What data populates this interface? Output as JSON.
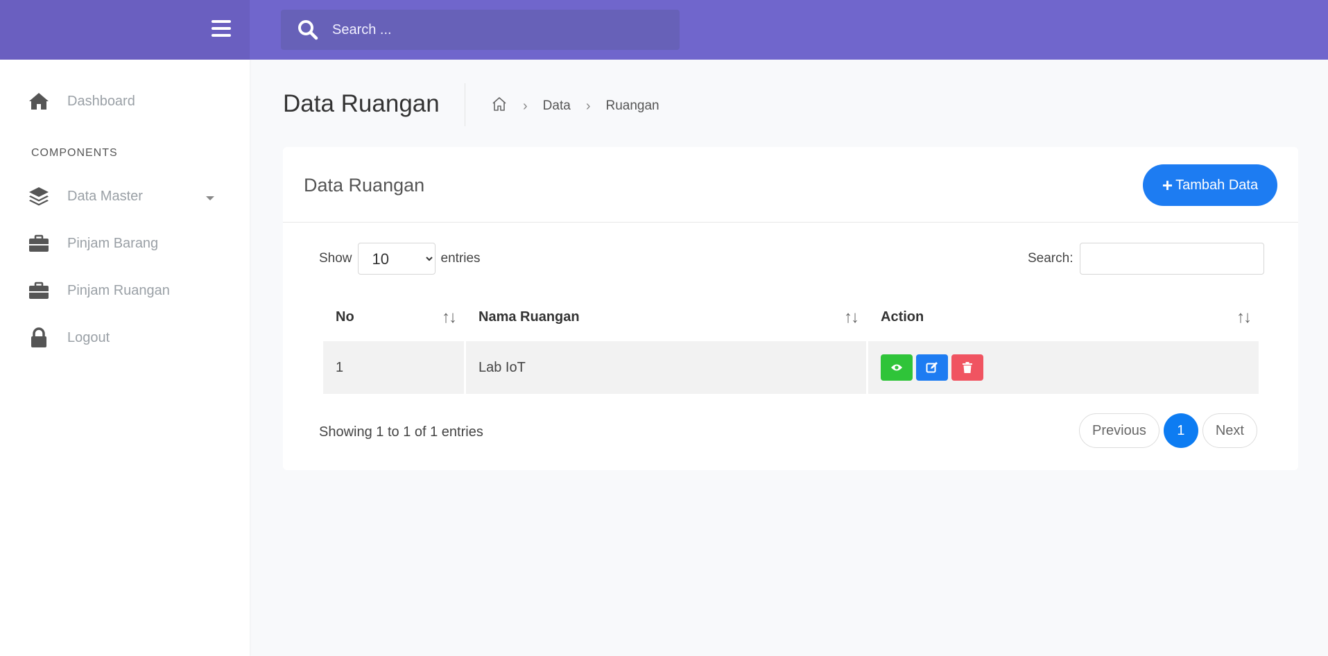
{
  "topbar": {
    "search_placeholder": "Search ...",
    "menu_icon": "hamburger-icon",
    "search_icon": "search-icon"
  },
  "sidebar": {
    "items": [
      {
        "label": "Dashboard",
        "icon": "home-icon"
      },
      {
        "label": "Data Master",
        "icon": "layers-icon"
      },
      {
        "label": "Pinjam Barang",
        "icon": "briefcase-icon"
      },
      {
        "label": "Pinjam Ruangan",
        "icon": "briefcase-icon"
      },
      {
        "label": "Logout",
        "icon": "lock-icon"
      }
    ],
    "section_label": "COMPONENTS"
  },
  "page": {
    "title": "Data Ruangan",
    "breadcrumb": [
      "Data",
      "Ruangan"
    ]
  },
  "card": {
    "title": "Data Ruangan",
    "add_button": "Tambah Data",
    "length_prefix": "Show",
    "length_value": "10",
    "length_suffix": "entries",
    "search_label": "Search:",
    "columns": [
      "No",
      "Nama Ruangan",
      "Action"
    ],
    "rows": [
      {
        "no": "1",
        "nama": "Lab IoT"
      }
    ],
    "info": "Showing 1 to 1 of 1 entries",
    "pagination": {
      "prev": "Previous",
      "current": "1",
      "next": "Next"
    }
  },
  "colors": {
    "header": "#7066cc",
    "primary": "#1d7cf2",
    "success": "#2fc439",
    "danger": "#f05461"
  }
}
